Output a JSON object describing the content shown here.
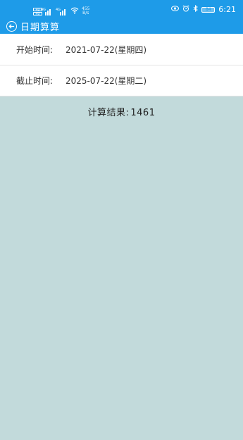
{
  "status_bar": {
    "sim1_label": "HD",
    "sim2_label": "HD",
    "signal1_label": "4G",
    "signal2_label": "4G",
    "net_speed_value": "455",
    "net_speed_unit": "B/s",
    "battery": "84",
    "time": "6:21"
  },
  "toolbar": {
    "title": "日期算算"
  },
  "form": {
    "start_label": "开始时间:",
    "start_value": "2021-07-22(星期四)",
    "end_label": "截止时间:",
    "end_value": "2025-07-22(星期二)"
  },
  "result": {
    "label": "计算结果:",
    "value": "1461"
  },
  "colors": {
    "accent": "#1e9be8",
    "background": "#c2dadb"
  }
}
